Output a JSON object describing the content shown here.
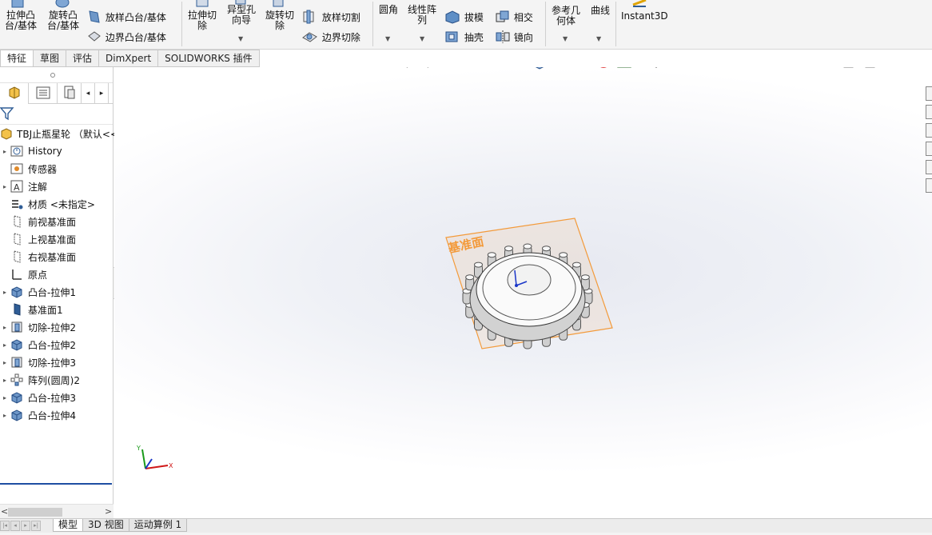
{
  "ribbon": {
    "extrude_boss": "拉伸凸台/基体",
    "extrude_boss_l1": "拉伸凸",
    "extrude_boss_l2": "台/基体",
    "revolve_boss_l1": "旋转凸",
    "revolve_boss_l2": "台/基体",
    "lofted_boss": "放样凸台/基体",
    "boundary_boss": "边界凸台/基体",
    "extrude_cut_l1": "拉伸切",
    "extrude_cut_l2": "除",
    "hole_wizard_l1": "异型孔",
    "hole_wizard_l2": "向导",
    "revolve_cut_l1": "旋转切",
    "revolve_cut_l2": "除",
    "lofted_cut": "放样切割",
    "boundary_cut": "边界切除",
    "fillet": "圆角",
    "linear_pattern_l1": "线性阵",
    "linear_pattern_l2": "列",
    "draft": "拔模",
    "shell": "抽壳",
    "intersect": "相交",
    "mirror": "镜向",
    "ref_geometry_l1": "参考几",
    "ref_geometry_l2": "何体",
    "curves": "曲线",
    "instant3d": "Instant3D"
  },
  "tabs": [
    "特征",
    "草图",
    "评估",
    "DimXpert",
    "SOLIDWORKS 插件"
  ],
  "tree": {
    "root": "TBJ止瓶星轮 （默认<<",
    "items": [
      {
        "label": "History",
        "icon": "history-icon",
        "expandable": true
      },
      {
        "label": "传感器",
        "icon": "sensor-icon",
        "expandable": false
      },
      {
        "label": "注解",
        "icon": "annotation-icon",
        "expandable": true
      },
      {
        "label": "材质 <未指定>",
        "icon": "material-icon",
        "expandable": false
      },
      {
        "label": "前视基准面",
        "icon": "plane-icon",
        "expandable": false
      },
      {
        "label": "上视基准面",
        "icon": "plane-icon",
        "expandable": false
      },
      {
        "label": "右视基准面",
        "icon": "plane-icon",
        "expandable": false
      },
      {
        "label": "原点",
        "icon": "origin-icon",
        "expandable": false
      },
      {
        "label": "凸台-拉伸1",
        "icon": "boss-extrude-icon",
        "expandable": true
      },
      {
        "label": "基准面1",
        "icon": "plane-solid-icon",
        "expandable": false
      },
      {
        "label": "切除-拉伸2",
        "icon": "cut-extrude-icon",
        "expandable": true
      },
      {
        "label": "凸台-拉伸2",
        "icon": "boss-extrude-icon",
        "expandable": true
      },
      {
        "label": "切除-拉伸3",
        "icon": "cut-extrude-icon",
        "expandable": true
      },
      {
        "label": "阵列(圆周)2",
        "icon": "circular-pattern-icon",
        "expandable": true
      },
      {
        "label": "凸台-拉伸3",
        "icon": "boss-extrude-icon",
        "expandable": true
      },
      {
        "label": "凸台-拉伸4",
        "icon": "boss-extrude-icon",
        "expandable": true
      }
    ]
  },
  "viewport": {
    "plane_label": "基准面",
    "triad_x": "X",
    "triad_y": "Y"
  },
  "bottom_tabs": [
    "模型",
    "3D 视图",
    "运动算例 1"
  ],
  "colors": {
    "plane_orange": "#f39a3a",
    "tree_selection": "#1f4ea3",
    "axis_x": "#d01818",
    "axis_y": "#1a9a1a",
    "axis_z": "#1a36c8"
  }
}
